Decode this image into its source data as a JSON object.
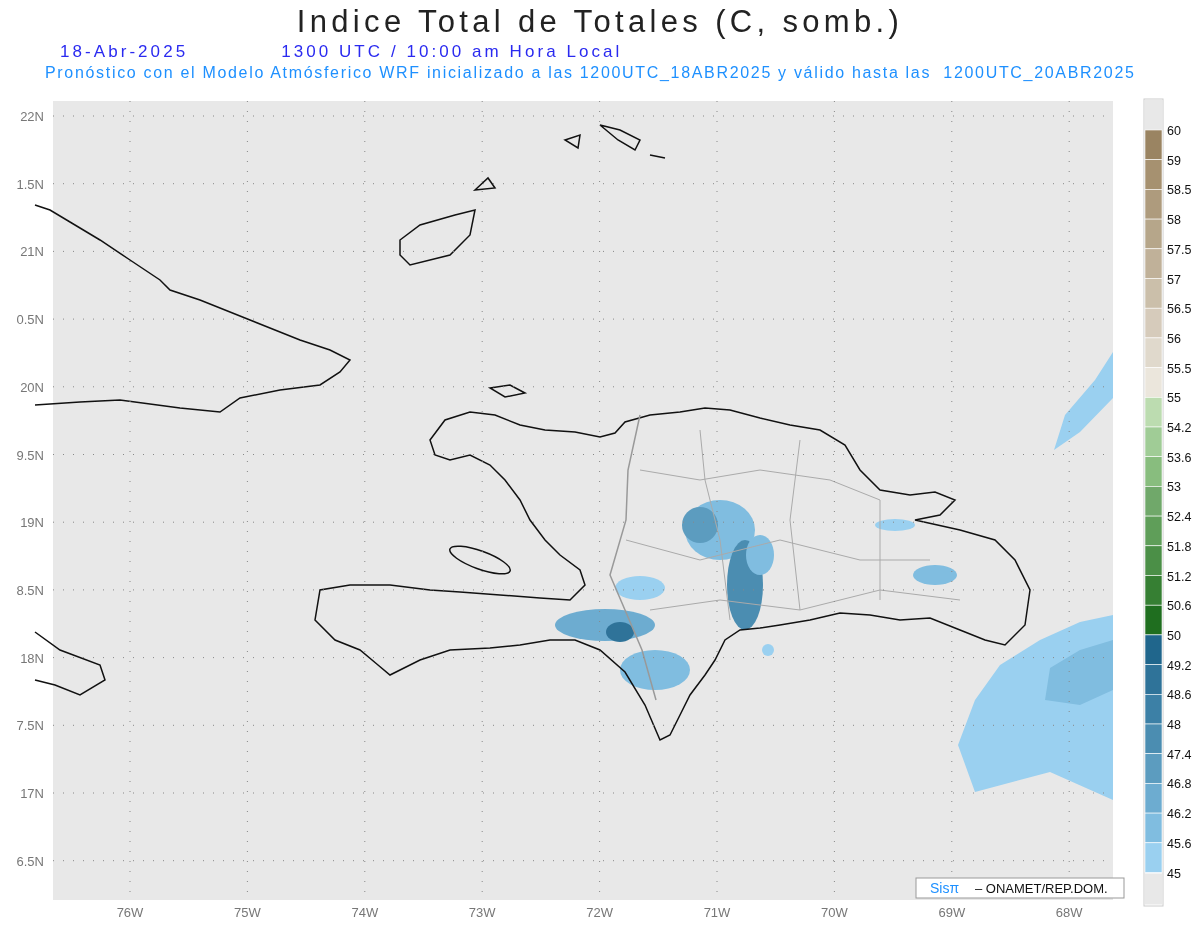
{
  "header": {
    "title": "Indice Total de Totales (C, somb.)",
    "date": "18-Abr-2025",
    "time": "1300 UTC / 10:00 am Hora Local",
    "subtitle": "Pronóstico con el Modelo Atmósferico WRF inicializado a las 1200UTC_18ABR2025 y válido hasta las  1200UTC_20ABR2025"
  },
  "map": {
    "lat_labels": [
      "22N",
      "1.5N",
      "21N",
      "0.5N",
      "20N",
      "9.5N",
      "19N",
      "8.5N",
      "18N",
      "7.5N",
      "17N",
      "6.5N"
    ],
    "lon_labels": [
      "76W",
      "75W",
      "74W",
      "73W",
      "72W",
      "71W",
      "70W",
      "69W",
      "68W"
    ],
    "credit": {
      "brand": "Sisπ",
      "text": "– ONAMET/REP.DOM."
    }
  },
  "legend": [
    {
      "label": "60",
      "color": "#9a8462"
    },
    {
      "label": "59",
      "color": "#a69170"
    },
    {
      "label": "58.5",
      "color": "#ae9b7d"
    },
    {
      "label": "58",
      "color": "#b6a68a"
    },
    {
      "label": "57.5",
      "color": "#c0b199"
    },
    {
      "label": "57",
      "color": "#cbbfaa"
    },
    {
      "label": "56.5",
      "color": "#d6cbbb"
    },
    {
      "label": "56",
      "color": "#e0d9cc"
    },
    {
      "label": "55.5",
      "color": "#ebe6dc"
    },
    {
      "label": "55",
      "color": "#bcdcb0"
    },
    {
      "label": "54.2",
      "color": "#a0cc96"
    },
    {
      "label": "53.6",
      "color": "#88bd7e"
    },
    {
      "label": "53",
      "color": "#70a86a"
    },
    {
      "label": "52.4",
      "color": "#5f9e59"
    },
    {
      "label": "51.8",
      "color": "#4b8f47"
    },
    {
      "label": "51.2",
      "color": "#367f33"
    },
    {
      "label": "50.6",
      "color": "#1f6e1f"
    },
    {
      "label": "50",
      "color": "#20668c"
    },
    {
      "label": "49.2",
      "color": "#2f7399"
    },
    {
      "label": "48.6",
      "color": "#3c80a6"
    },
    {
      "label": "48",
      "color": "#4b8db1"
    },
    {
      "label": "47.4",
      "color": "#5c9cbf"
    },
    {
      "label": "46.8",
      "color": "#6dacd0"
    },
    {
      "label": "46.2",
      "color": "#80bde0"
    },
    {
      "label": "45.6",
      "color": "#9ad0f0"
    },
    {
      "label": "45",
      "color": "#e8e8e8"
    }
  ]
}
